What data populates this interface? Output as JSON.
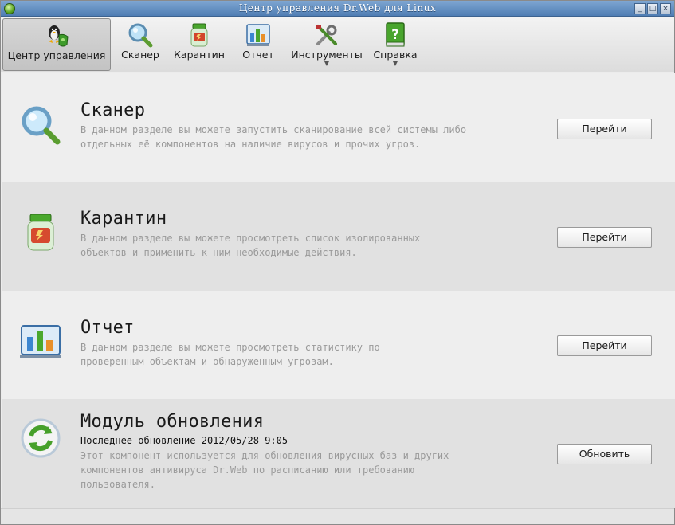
{
  "window": {
    "title": "Центр управления Dr.Web для Linux",
    "controls": [
      "_",
      "□",
      "×"
    ]
  },
  "toolbar": {
    "items": [
      {
        "label": "Центр управления",
        "icon": "control-center-icon",
        "active": true
      },
      {
        "label": "Сканер",
        "icon": "magnifier-icon"
      },
      {
        "label": "Карантин",
        "icon": "quarantine-jar-icon"
      },
      {
        "label": "Отчет",
        "icon": "report-chart-icon"
      },
      {
        "label": "Инструменты",
        "icon": "tools-icon",
        "dropdown": true
      },
      {
        "label": "Справка",
        "icon": "help-book-icon",
        "dropdown": true
      }
    ]
  },
  "sections": [
    {
      "title": "Сканер",
      "description": "В данном разделе вы можете запустить сканирование всей системы либо\nотдельных её компонентов на наличие вирусов и прочих угроз.",
      "button": "Перейти",
      "icon": "magnifier-icon"
    },
    {
      "title": "Карантин",
      "description": "В данном разделе вы можете просмотреть список изолированных\nобъектов и применить к ним необходимые действия.",
      "button": "Перейти",
      "icon": "quarantine-jar-icon"
    },
    {
      "title": "Отчет",
      "description": "В данном разделе вы можете просмотреть статистику по\nпроверенным объектам и обнаруженным угрозам.",
      "button": "Перейти",
      "icon": "report-chart-icon"
    },
    {
      "title": "Модуль обновления",
      "last_update": "Последнее обновление 2012/05/28  9:05",
      "description": "Этот компонент используется для обновления вирусных баз и других\nкомпонентов антивируса Dr.Web по расписанию или требованию\nпользователя.",
      "button": "Обновить",
      "icon": "update-refresh-icon"
    }
  ]
}
